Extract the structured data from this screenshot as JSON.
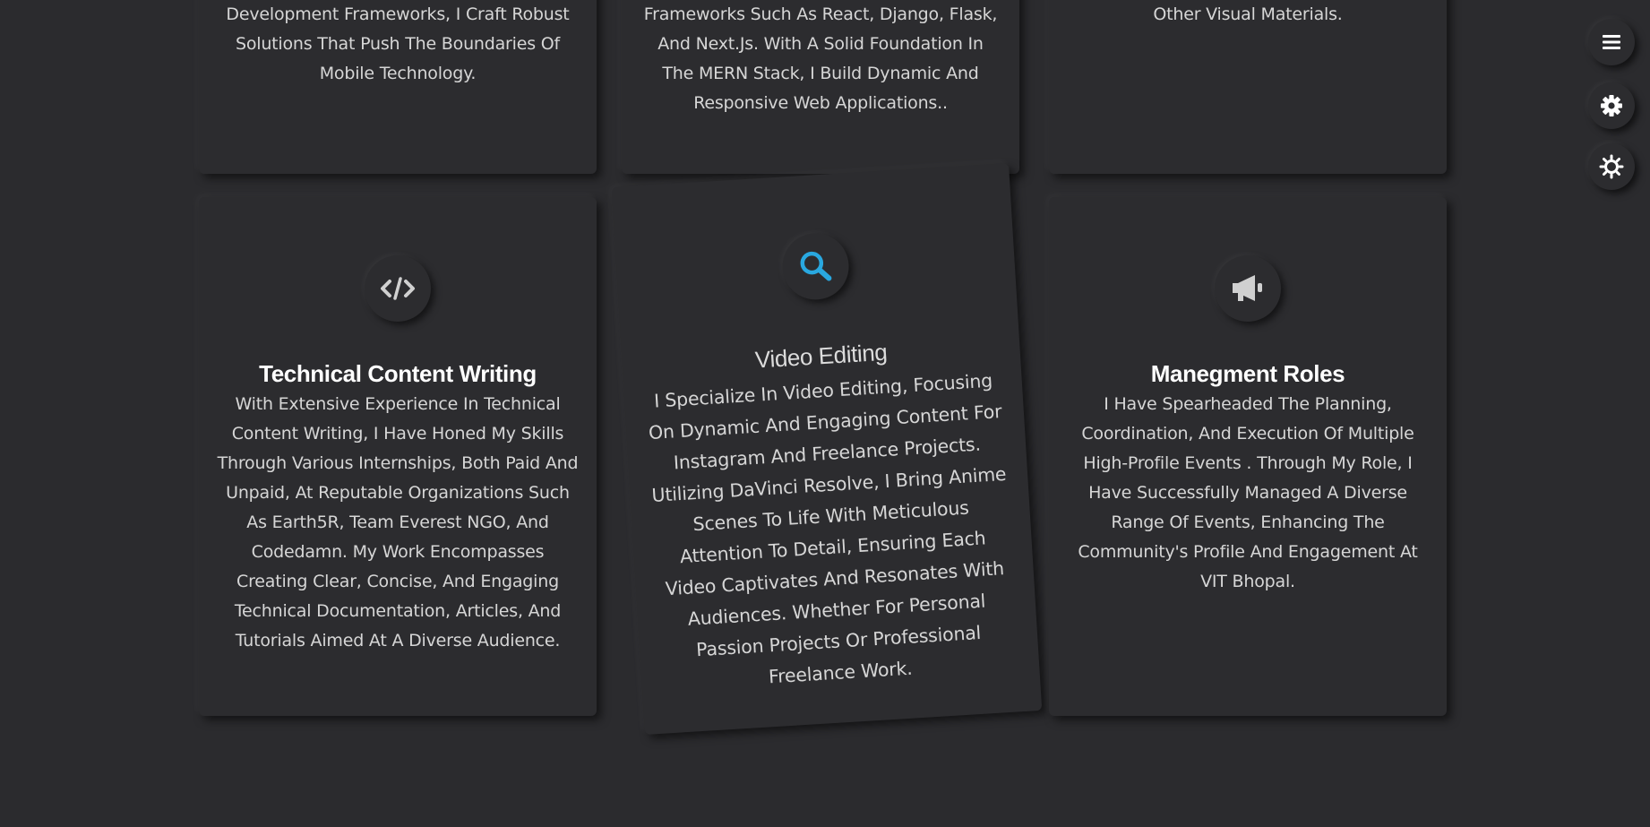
{
  "top_cards": [
    {
      "description": "Development Frameworks, I Craft Robust Solutions That Push The Boundaries Of Mobile Technology."
    },
    {
      "description": "Frameworks Such As React, Django, Flask, And Next.Js. With A Solid Foundation In The MERN Stack, I Build Dynamic And Responsive Web Applications.."
    },
    {
      "description": "Other Visual Materials."
    }
  ],
  "cards": [
    {
      "icon": "code-icon",
      "title": "Technical Content Writing",
      "description": "With Extensive Experience In Technical Content Writing, I Have Honed My Skills Through Various Internships, Both Paid And Unpaid, At Reputable Organizations Such As Earth5R, Team Everest NGO, And Codedamn. My Work Encompasses Creating Clear, Concise, And Engaging Technical Documentation, Articles, And Tutorials Aimed At A Diverse Audience."
    },
    {
      "icon": "search-icon",
      "title": "Video Editing",
      "description": "I Specialize In Video Editing, Focusing On Dynamic And Engaging Content For Instagram And Freelance Projects. Utilizing DaVinci Resolve, I Bring Anime Scenes To Life With Meticulous Attention To Detail, Ensuring Each Video Captivates And Resonates With Audiences. Whether For Personal Passion Projects Or Professional Freelance Work."
    },
    {
      "icon": "megaphone-icon",
      "title": "Manegment Roles",
      "description": "I Have Spearheaded The Planning, Coordination, And Execution Of Multiple High-Profile Events . Through My Role, I Have Successfully Managed A Diverse Range Of Events, Enhancing The Community's Profile And Engagement At VIT Bhopal."
    }
  ],
  "side_controls": [
    {
      "icon": "hamburger-menu-icon"
    },
    {
      "icon": "gear-icon"
    },
    {
      "icon": "sun-icon"
    }
  ],
  "colors": {
    "background": "#2b2b2e",
    "accent": "#29a8e0",
    "icon_gray": "#d0d0d0"
  }
}
